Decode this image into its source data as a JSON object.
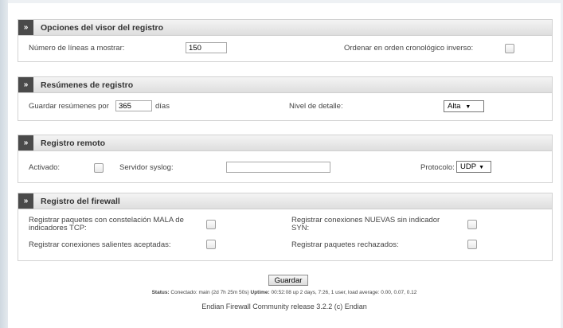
{
  "sections": [
    {
      "title": "Opciones del visor del registro"
    },
    {
      "title": "Resúmenes de registro"
    },
    {
      "title": "Registro remoto"
    },
    {
      "title": "Registro del firewall"
    }
  ],
  "viewer": {
    "lines_label": "Número de líneas a mostrar:",
    "lines_value": "150",
    "reverse_label": "Ordenar en orden cronológico inverso:"
  },
  "summaries": {
    "keep_label": "Guardar resúmenes por",
    "keep_value": "365",
    "days_label": "días",
    "detail_label": "Nivel de detalle:",
    "detail_value": "Alta"
  },
  "remote": {
    "enabled_label": "Activado:",
    "server_label": "Servidor syslog:",
    "server_value": "",
    "protocol_label": "Protocolo:",
    "protocol_value": "UDP"
  },
  "firewall": {
    "bad_tcp_label": "Registrar paquetes con constelación MALA de indicadores TCP:",
    "new_nosyn_label": "Registrar conexiones NUEVAS sin indicador SYN:",
    "outgoing_label": "Registrar conexiones salientes aceptadas:",
    "rejected_label": "Registrar paquetes rechazados:"
  },
  "save_label": "Guardar",
  "status": {
    "status_key": "Status:",
    "status_value": "Conectado: main (2d 7h 25m 50s)",
    "uptime_key": "Uptime:",
    "uptime_value": "00:52:08 up 2 days, 7:26, 1 user, load average: 0.00, 0.07, 0.12"
  },
  "footer": "Endian Firewall Community release 3.2.2 (c) Endian",
  "icons": {
    "section_toggle": "double-chevron-right-icon",
    "select_arrow": "triangle-down-icon"
  }
}
